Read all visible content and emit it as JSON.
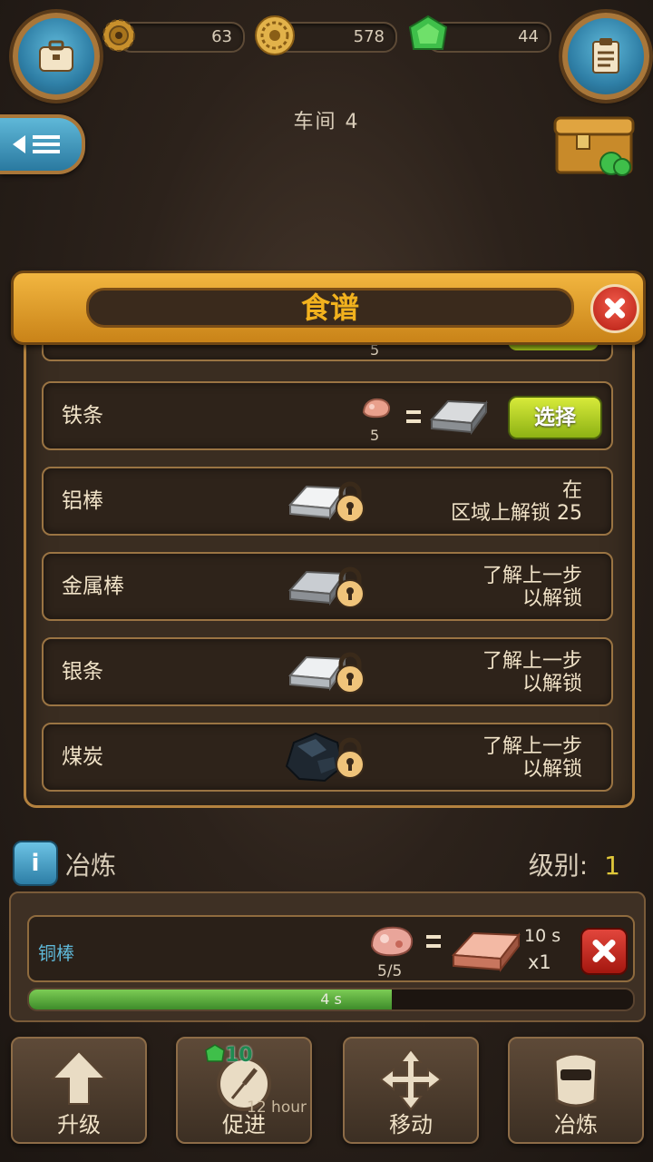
{
  "top_bar": {
    "gears": "63",
    "coins": "578",
    "gems": "44"
  },
  "workshop_title": "车间 4",
  "recipe_panel": {
    "title": "食谱",
    "partial_row_qty": "5",
    "rows": [
      {
        "label": "铁条",
        "qty": "5",
        "button": "选择"
      },
      {
        "label": "铝棒",
        "lock_line1": "在",
        "lock_line2": "区域上解锁 25"
      },
      {
        "label": "金属棒",
        "lock_line1": "了解上一步",
        "lock_line2": "以解锁"
      },
      {
        "label": "银条",
        "lock_line1": "了解上一步",
        "lock_line2": "以解锁"
      },
      {
        "label": "煤炭",
        "lock_line1": "了解上一步",
        "lock_line2": "以解锁"
      }
    ]
  },
  "smelting": {
    "info": "i",
    "title": "冶炼",
    "level_label": "级别:",
    "level_value": "1",
    "item_name": "铜棒",
    "input_qty": "5/5",
    "time": "10 s",
    "output_count": "x1",
    "progress_text": "4 s",
    "progress_fraction": 0.6
  },
  "bottom_tabs": {
    "upgrade": "升级",
    "boost": "促进",
    "boost_gems": "10",
    "boost_time": "12 hour",
    "move": "移动",
    "smelt": "冶炼"
  },
  "colors": {
    "accent_orange": "#f2b640",
    "select_green": "#b4d02a",
    "gem_green": "#3fbf4a",
    "progress_green": "#5db33c"
  }
}
